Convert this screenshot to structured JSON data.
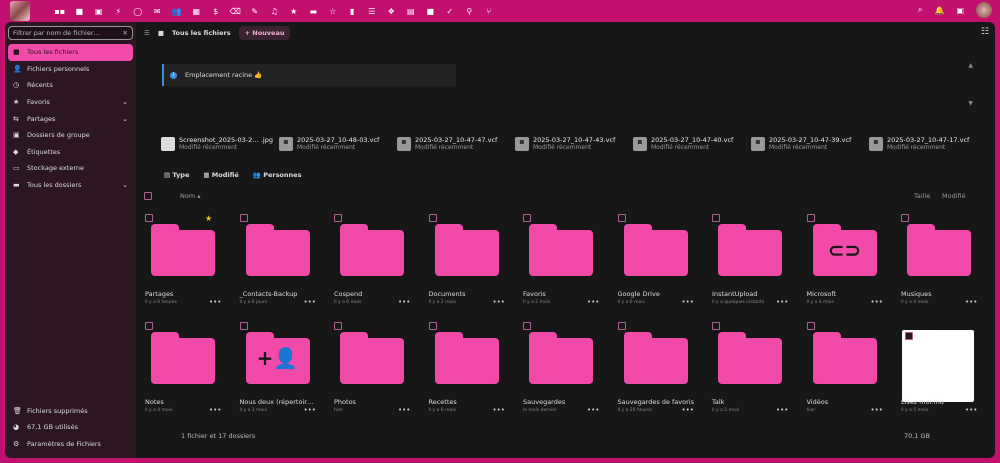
{
  "topbar": {
    "apps": [
      "dashboard-icon",
      "files-icon",
      "photos-icon",
      "activity-icon",
      "talk-icon",
      "mail-icon",
      "contacts-icon",
      "calendar-icon",
      "cospend-icon",
      "cleanup-icon",
      "notes-icon",
      "music-icon",
      "favorites-icon",
      "deck-icon",
      "rating-icon",
      "analytics-icon",
      "tasks-icon",
      "bookmarks-icon",
      "forms-icon",
      "video-icon",
      "checklist-icon",
      "maps-icon",
      "recipes-icon"
    ],
    "right": [
      "search-icon",
      "bell-icon",
      "contacts-menu-icon"
    ]
  },
  "sidebar": {
    "filter_placeholder": "Filtrer par nom de fichier…",
    "items": [
      {
        "label": "Tous les fichiers",
        "icon": "■",
        "active": true
      },
      {
        "label": "Fichiers personnels",
        "icon": "👤"
      },
      {
        "label": "Récents",
        "icon": "◷"
      },
      {
        "label": "Favoris",
        "icon": "★",
        "chev": true
      },
      {
        "label": "Partages",
        "icon": "⇆",
        "chev": true
      },
      {
        "label": "Dossiers de groupe",
        "icon": "▣"
      },
      {
        "label": "Étiquettes",
        "icon": "◆"
      },
      {
        "label": "Stockage externe",
        "icon": "▭"
      },
      {
        "label": "Tous les dossiers",
        "icon": "▬",
        "chev": true
      }
    ],
    "bottom": [
      {
        "label": "Fichiers supprimés",
        "icon": "🗑"
      },
      {
        "label": "67,1 GB utilisés",
        "icon": "◕"
      },
      {
        "label": "Paramètres de Fichiers",
        "icon": "⚙"
      }
    ]
  },
  "main": {
    "breadcrumb": "Tous les fichiers",
    "new_label": "+ Nouveau",
    "note": "Emplacement racine 👍",
    "recents": [
      {
        "name": "Screenshot_2025-03-2… .jpg",
        "sub": "Modifié récemment"
      },
      {
        "name": "2025-03-27_10-48-03.vcf",
        "sub": "Modifié récemment"
      },
      {
        "name": "2025-03-27_10-47-47.vcf",
        "sub": "Modifié récemment"
      },
      {
        "name": "2025-03-27_10-47-43.vcf",
        "sub": "Modifié récemment"
      },
      {
        "name": "2025-03-27_10-47-40.vcf",
        "sub": "Modifié récemment"
      },
      {
        "name": "2025-03-27_10-47-39.vcf",
        "sub": "Modifié récemment"
      },
      {
        "name": "2025-03-27_10-47-17.vcf",
        "sub": "Modifié récemment"
      }
    ],
    "filters": [
      "Type",
      "Modifié",
      "Personnes"
    ],
    "columns": {
      "name": "Nom ▴",
      "size": "Taille",
      "modified": "Modifié"
    },
    "files": [
      {
        "name": "Partages",
        "sub": "Il y a 6 heures",
        "star": true
      },
      {
        "name": "_Contacts-Backup",
        "sub": "Il y a 6 jours"
      },
      {
        "name": "Cospend",
        "sub": "Il y a 6 mois"
      },
      {
        "name": "Documents",
        "sub": "Il y a 2 mois"
      },
      {
        "name": "Favoris",
        "sub": "Il y a 2 mois"
      },
      {
        "name": "Google Drive",
        "sub": "Il y a 6 mois"
      },
      {
        "name": "InstantUpload",
        "sub": "Il y a quelques instants"
      },
      {
        "name": "Microsoft",
        "sub": "Il y a 4 mois",
        "glyph": "🔗"
      },
      {
        "name": "Musiques",
        "sub": "Il y a 4 mois"
      },
      {
        "name": "Notes",
        "sub": "Il y a 4 mois"
      },
      {
        "name": "Nous deux (répertoir…",
        "sub": "Il y a 1 mois",
        "glyph": "+👤"
      },
      {
        "name": "Photos",
        "sub": "hier"
      },
      {
        "name": "Recettes",
        "sub": "Il y a 6 mois"
      },
      {
        "name": "Sauvegardes",
        "sub": "le mois dernier"
      },
      {
        "name": "Sauvegardes de favoris",
        "sub": "Il y a 20 heures"
      },
      {
        "name": "Talk",
        "sub": "Il y a 5 mois"
      },
      {
        "name": "Vidéos",
        "sub": "hier"
      },
      {
        "name": "Lisez moi.md",
        "sub": "Il y a 5 mois",
        "doc": true
      }
    ],
    "summary": "1 fichier et 17 dossiers",
    "total_size": "70,1 GB"
  },
  "colors": {
    "accent": "#f24aa8",
    "topbar": "#c2106f"
  }
}
